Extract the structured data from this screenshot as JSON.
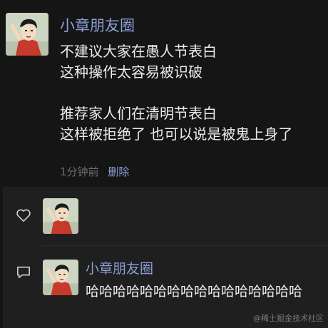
{
  "post": {
    "author": "小章朋友圈",
    "paragraphs": [
      [
        "不建议大家在愚人节表白",
        "这种操作太容易被识破"
      ],
      [
        "推荐家人们在清明节表白",
        "这样被拒绝了 也可以说是被鬼上身了"
      ]
    ],
    "time": "1分钟前",
    "delete_label": "删除"
  },
  "interactions": {
    "like_icon": "heart-outline-icon",
    "comment_icon": "comment-bubble-icon",
    "comment": {
      "author": "小章朋友圈",
      "text": "哈哈哈哈哈哈哈哈哈哈哈哈哈哈哈哈"
    }
  },
  "watermark": "@稀土掘金技术社区",
  "colors": {
    "background": "#151515",
    "panel": "#1f1f1f",
    "name_link": "#8b9fd6",
    "meta_gray": "#6c6c6c"
  }
}
